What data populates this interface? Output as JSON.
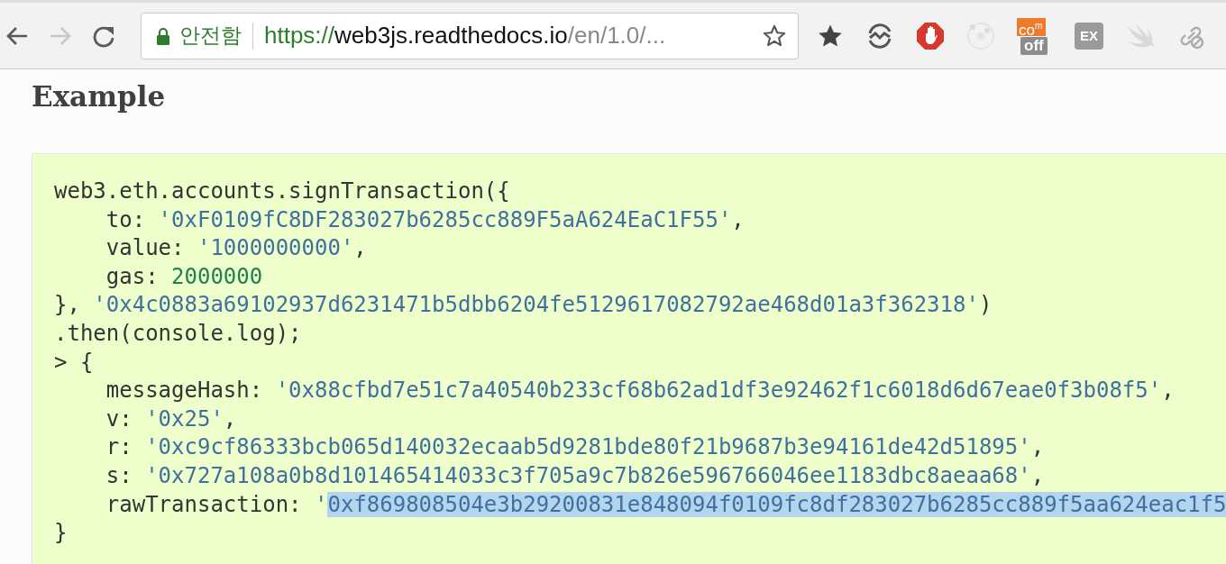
{
  "browser": {
    "back_enabled": true,
    "forward_enabled": false,
    "security_label": "안전함",
    "url": {
      "scheme": "https://",
      "host": "web3js.readthedocs.io",
      "path": "/en/1.0/..."
    },
    "extensions": [
      {
        "kind": "star"
      },
      {
        "kind": "sync"
      },
      {
        "kind": "blocker"
      },
      {
        "kind": "faint-circle"
      },
      {
        "kind": "badge",
        "text": "co",
        "sup": "m",
        "badge": "off"
      },
      {
        "kind": "tile",
        "text": "EX"
      },
      {
        "kind": "bird"
      },
      {
        "kind": "link"
      }
    ]
  },
  "heading": "Example",
  "code_lines": [
    {
      "indent": false,
      "tokens": [
        {
          "kind": "plain",
          "text": "web3.eth.accounts.signTransaction({",
          "selected": false
        }
      ]
    },
    {
      "indent": true,
      "tokens": [
        {
          "kind": "plain",
          "text": "to: ",
          "selected": false
        },
        {
          "kind": "string",
          "text": "'0xF0109fC8DF283027b6285cc889F5aA624EaC1F55'",
          "selected": false
        },
        {
          "kind": "plain",
          "text": ",",
          "selected": false
        }
      ]
    },
    {
      "indent": true,
      "tokens": [
        {
          "kind": "plain",
          "text": "value: ",
          "selected": false
        },
        {
          "kind": "string",
          "text": "'1000000000'",
          "selected": false
        },
        {
          "kind": "plain",
          "text": ",",
          "selected": false
        }
      ]
    },
    {
      "indent": true,
      "tokens": [
        {
          "kind": "plain",
          "text": "gas: ",
          "selected": false
        },
        {
          "kind": "number",
          "text": "2000000",
          "selected": false
        }
      ]
    },
    {
      "indent": false,
      "tokens": [
        {
          "kind": "plain",
          "text": "}, ",
          "selected": false
        },
        {
          "kind": "string",
          "text": "'0x4c0883a69102937d6231471b5dbb6204fe5129617082792ae468d01a3f362318'",
          "selected": false
        },
        {
          "kind": "plain",
          "text": ")",
          "selected": false
        }
      ]
    },
    {
      "indent": false,
      "tokens": [
        {
          "kind": "plain",
          "text": ".then(console.log);",
          "selected": false
        }
      ]
    },
    {
      "indent": false,
      "tokens": [
        {
          "kind": "plain",
          "text": "> {",
          "selected": false
        }
      ]
    },
    {
      "indent": true,
      "tokens": [
        {
          "kind": "plain",
          "text": "messageHash: ",
          "selected": false
        },
        {
          "kind": "string",
          "text": "'0x88cfbd7e51c7a40540b233cf68b62ad1df3e92462f1c6018d6d67eae0f3b08f5'",
          "selected": false
        },
        {
          "kind": "plain",
          "text": ",",
          "selected": false
        }
      ]
    },
    {
      "indent": true,
      "tokens": [
        {
          "kind": "plain",
          "text": "v: ",
          "selected": false
        },
        {
          "kind": "string",
          "text": "'0x25'",
          "selected": false
        },
        {
          "kind": "plain",
          "text": ",",
          "selected": false
        }
      ]
    },
    {
      "indent": true,
      "tokens": [
        {
          "kind": "plain",
          "text": "r: ",
          "selected": false
        },
        {
          "kind": "string",
          "text": "'0xc9cf86333bcb065d140032ecaab5d9281bde80f21b9687b3e94161de42d51895'",
          "selected": false
        },
        {
          "kind": "plain",
          "text": ",",
          "selected": false
        }
      ]
    },
    {
      "indent": true,
      "tokens": [
        {
          "kind": "plain",
          "text": "s: ",
          "selected": false
        },
        {
          "kind": "string",
          "text": "'0x727a108a0b8d101465414033c3f705a9c7b826e596766046ee1183dbc8aeaa68'",
          "selected": false
        },
        {
          "kind": "plain",
          "text": ",",
          "selected": false
        }
      ]
    },
    {
      "indent": true,
      "tokens": [
        {
          "kind": "plain",
          "text": "rawTransaction: ",
          "selected": false
        },
        {
          "kind": "string",
          "text": "'",
          "selected": false
        },
        {
          "kind": "string",
          "text": "0xf869808504e3b29200831e848094f0109fc8df283027b6285cc889f5aa624eac1f5",
          "selected": true
        }
      ]
    },
    {
      "indent": false,
      "tokens": [
        {
          "kind": "plain",
          "text": "}",
          "selected": false
        }
      ]
    }
  ]
}
